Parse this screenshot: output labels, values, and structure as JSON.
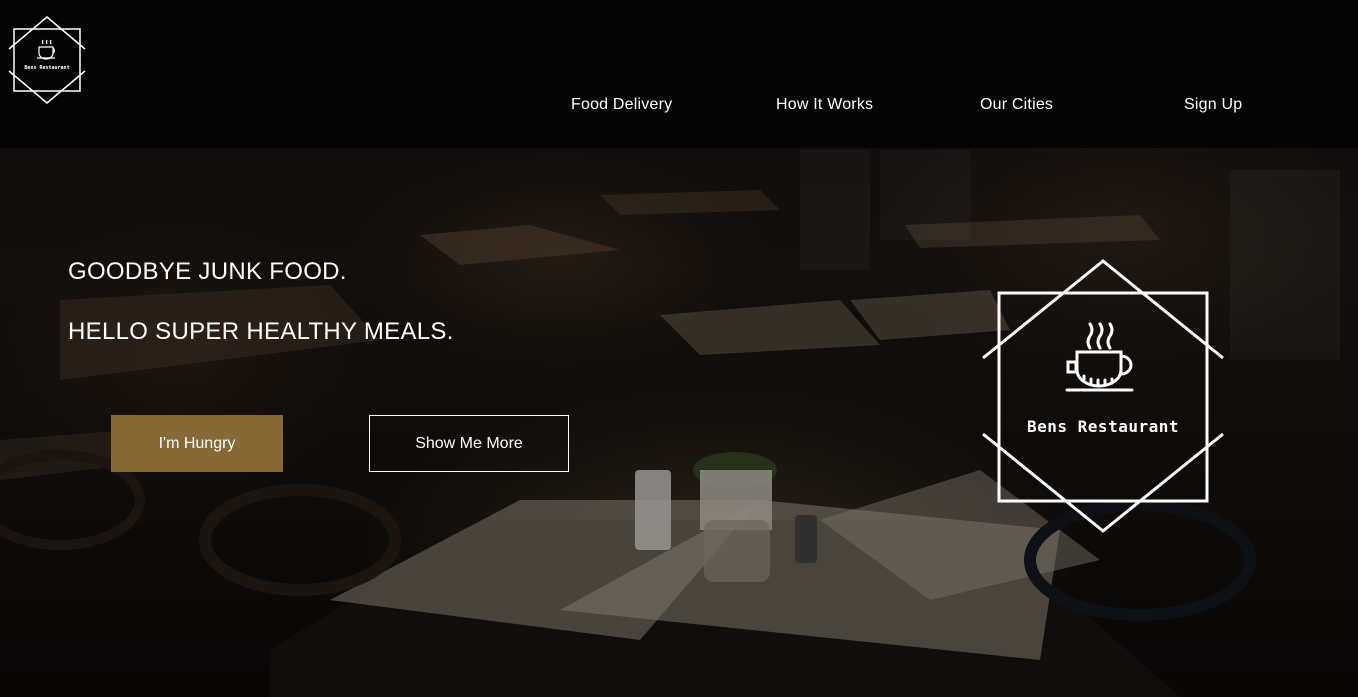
{
  "brand": {
    "name": "Bens Restaurant",
    "logo_icon": "coffee-cup-icon"
  },
  "nav": {
    "items": [
      {
        "label": "Food Delivery"
      },
      {
        "label": "How It Works"
      },
      {
        "label": "Our Cities"
      },
      {
        "label": "Sign Up"
      }
    ]
  },
  "hero": {
    "headline_line1": "GOODBYE JUNK FOOD.",
    "headline_line2": "HELLO SUPER HEALTHY MEALS.",
    "primary_button": "I'm Hungry",
    "secondary_button": "Show Me More"
  },
  "colors": {
    "accent": "#866934",
    "header_bg": "#030303",
    "text": "#ffffff"
  }
}
